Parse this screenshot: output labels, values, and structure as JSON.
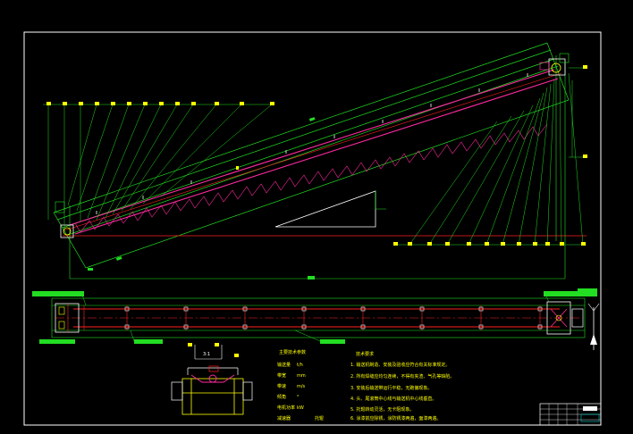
{
  "drawing": {
    "background": "#000000",
    "colors": {
      "frame": "#ffffff",
      "dimension": "#22dd22",
      "conveyor_truss": "#ff2aa0",
      "centerline": "#ff2020",
      "text": "#ffff00",
      "title_block": "#00cccc"
    }
  },
  "section_view": {
    "scale_label": "3:1"
  },
  "parameters_table": {
    "heading": "主要技术参数",
    "rows": [
      {
        "label": "输送量",
        "value": "t/h"
      },
      {
        "label": "带宽",
        "value": "mm"
      },
      {
        "label": "带速",
        "value": "m/s"
      },
      {
        "label": "倾角",
        "value": "°"
      },
      {
        "label": "电机功率",
        "value": "kW"
      },
      {
        "label": "减速器",
        "value": ""
      },
      {
        "label": "托辊",
        "value": ""
      }
    ]
  },
  "tech_requirements": {
    "heading": "技术要求",
    "items": [
      "1. 输送机制造、安装及验收应符合有关标准规定。",
      "2. 所有焊缝应均匀连续，不得有夹渣、气孔等缺陷。",
      "3. 安装后输送带运行平稳，无跑偏现象。",
      "4. 头、尾滚筒中心线与输送机中心线垂直。",
      "5. 托辊转动灵活，无卡阻现象。",
      "6. 涂漆前应除锈，涂防锈漆两遍，面漆两遍。"
    ]
  },
  "title_block": {
    "title": ""
  }
}
